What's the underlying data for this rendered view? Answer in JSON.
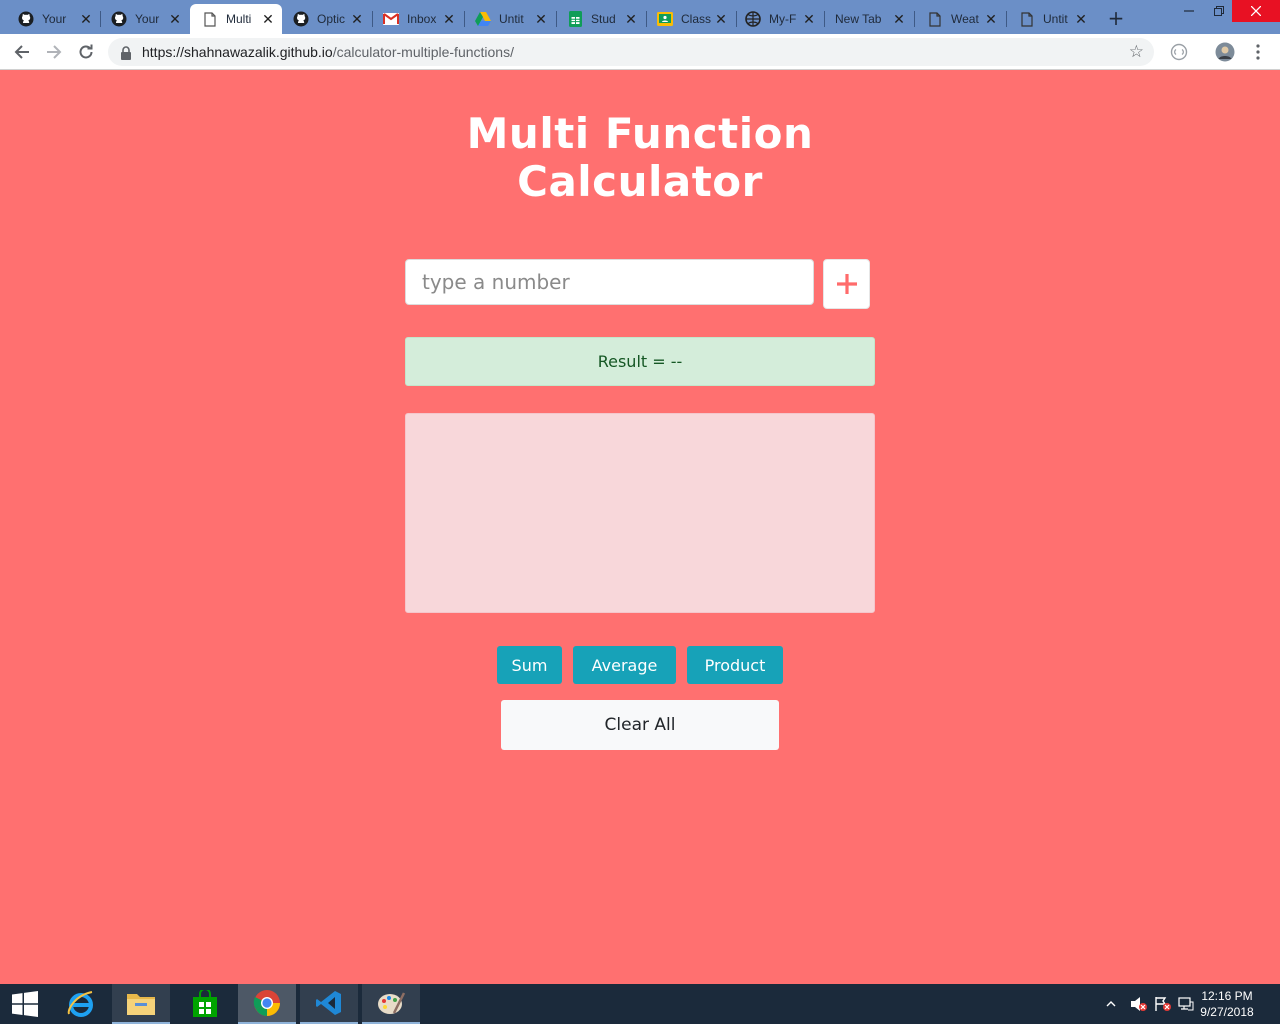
{
  "browser": {
    "tabs": [
      {
        "label": "Your",
        "icon": "github-icon",
        "active": false
      },
      {
        "label": "Your",
        "icon": "github-icon",
        "active": false
      },
      {
        "label": "Multi",
        "icon": "page-icon",
        "active": true
      },
      {
        "label": "Optic",
        "icon": "github-icon",
        "active": false
      },
      {
        "label": "Inbox",
        "icon": "gmail-icon",
        "active": false
      },
      {
        "label": "Untit",
        "icon": "drive-icon",
        "active": false
      },
      {
        "label": "Stud",
        "icon": "sheets-icon",
        "active": false
      },
      {
        "label": "Class",
        "icon": "classroom-icon",
        "active": false
      },
      {
        "label": "My-F",
        "icon": "globe-icon",
        "active": false
      },
      {
        "label": "New Tab",
        "icon": "",
        "active": false
      },
      {
        "label": "Weat",
        "icon": "page-icon",
        "active": false
      },
      {
        "label": "Untit",
        "icon": "page-icon",
        "active": false
      }
    ],
    "url_host": "https://shahnawazalik.github.io",
    "url_path": "/calculator-multiple-functions/"
  },
  "app": {
    "title_line1": "Multi Function",
    "title_line2": "Calculator",
    "input_placeholder": "type a number",
    "add_label": "+",
    "result_text": "Result = --",
    "buttons": {
      "sum": "Sum",
      "average": "Average",
      "product": "Product",
      "clear": "Clear All"
    }
  },
  "taskbar": {
    "time": "12:16 PM",
    "date": "9/27/2018"
  },
  "colors": {
    "page_bg": "#ff7070",
    "op_button": "#17a2b8",
    "result_bg": "#d4edda",
    "list_bg": "#f8d7da",
    "plus": "#ff6b6b"
  }
}
